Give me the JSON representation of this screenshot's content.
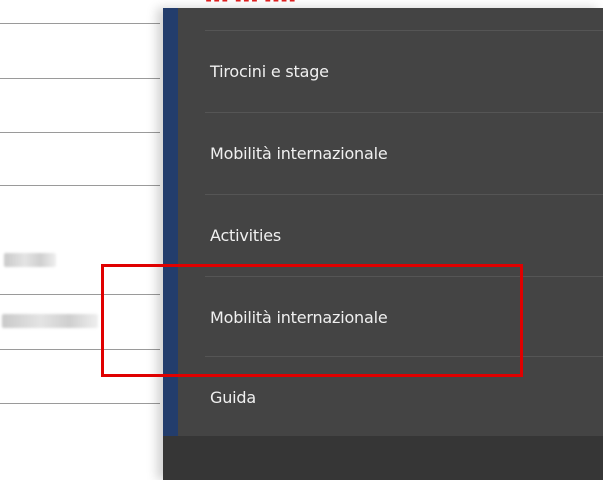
{
  "menu": {
    "items": [
      {
        "label": "Tirocini e stage"
      },
      {
        "label": "Mobilità internazionale"
      },
      {
        "label": "Activities"
      },
      {
        "label": "Mobilità internazionale"
      },
      {
        "label": "Guida"
      }
    ]
  },
  "highlight": {
    "color": "#e00000",
    "target_item_index": 3
  },
  "colors": {
    "panel_background": "#444444",
    "accent_stripe": "#233d6c",
    "footer_background": "#363636",
    "menu_text": "#f0f0f0"
  }
}
